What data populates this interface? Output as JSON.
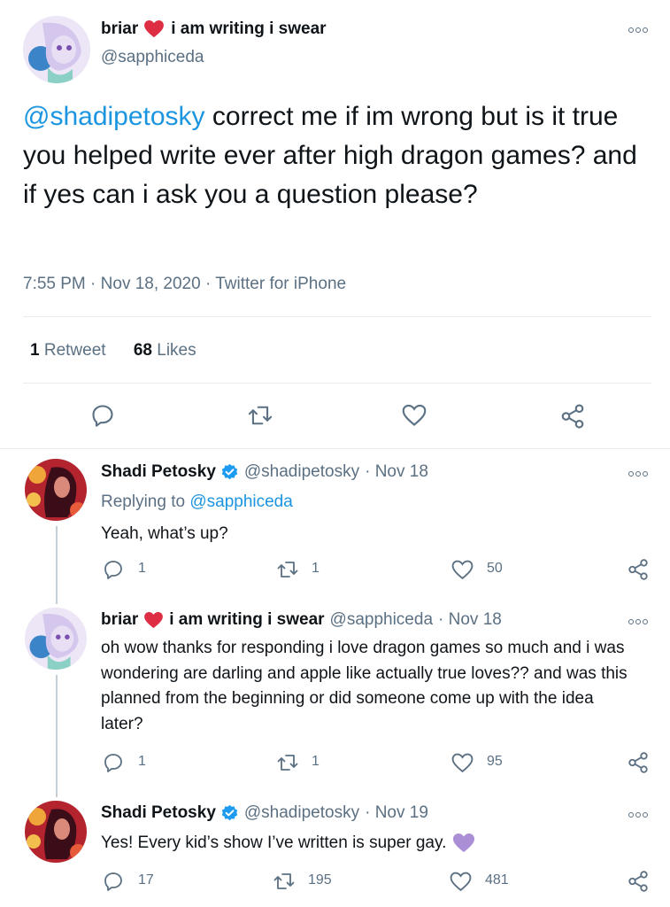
{
  "main_tweet": {
    "display_name": "briar",
    "display_name_suffix": "i am writing i swear",
    "handle": "@sapphiceda",
    "mention": "@shadipetosky",
    "text": " correct me if im wrong but is it true you helped write ever after high dragon games? and if yes can i ask you a question please?",
    "time": "7:55 PM",
    "date": "Nov 18, 2020",
    "source": "Twitter for iPhone",
    "retweets_count": "1",
    "retweets_label": "Retweet",
    "likes_count": "68",
    "likes_label": "Likes"
  },
  "replies": [
    {
      "display_name": "Shadi Petosky",
      "handle": "@shadipetosky",
      "date": "· Nov 18",
      "replying_to_label": "Replying to",
      "replying_to_handle": "@sapphiceda",
      "text": "Yeah, what’s up?",
      "reply_count": "1",
      "retweet_count": "1",
      "like_count": "50"
    },
    {
      "display_name": "briar",
      "display_name_suffix": "i am writing i swear",
      "handle": "@sapphiceda",
      "date": "· Nov 18",
      "text": "oh wow thanks for responding i love dragon games so much and i was wondering are darling and apple like actually true loves?? and was this planned from the beginning or did someone come up with the idea later?",
      "reply_count": "1",
      "retweet_count": "1",
      "like_count": "95"
    },
    {
      "display_name": "Shadi Petosky",
      "handle": "@shadipetosky",
      "date": "· Nov 19",
      "text": "Yes! Every kid’s show I’ve written is super gay.",
      "reply_count": "17",
      "retweet_count": "195",
      "like_count": "481"
    }
  ],
  "colors": {
    "accent": "#1b95e0",
    "heart": "#e0245e",
    "purple_heart": "#aa8ed6",
    "verified": "#1d9bf0",
    "secondary_text": "#5b7083"
  }
}
